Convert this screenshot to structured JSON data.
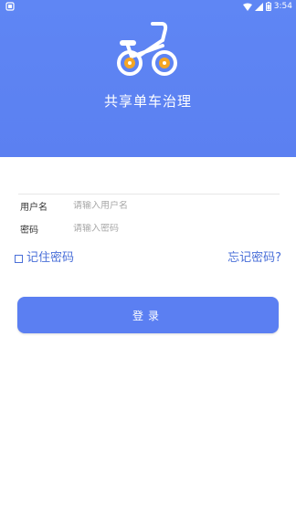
{
  "status_bar": {
    "time": "3:54",
    "left_icon": "notification-icon",
    "right_icons": [
      "wifi-icon",
      "signal-icon",
      "battery-icon"
    ]
  },
  "header": {
    "logo_icon": "bicycle-icon",
    "title": "共享单车治理",
    "background_color": "#5f86f4"
  },
  "form": {
    "username_label": "用户名",
    "username_placeholder": "请输入用户名",
    "username_value": "",
    "password_label": "密码",
    "password_placeholder": "请输入密码",
    "password_value": ""
  },
  "options": {
    "remember_label": "记住密码",
    "remember_checked": false,
    "forgot_label": "忘记密码?"
  },
  "actions": {
    "login_label": "登录",
    "accent_color": "#5b7ff2"
  }
}
